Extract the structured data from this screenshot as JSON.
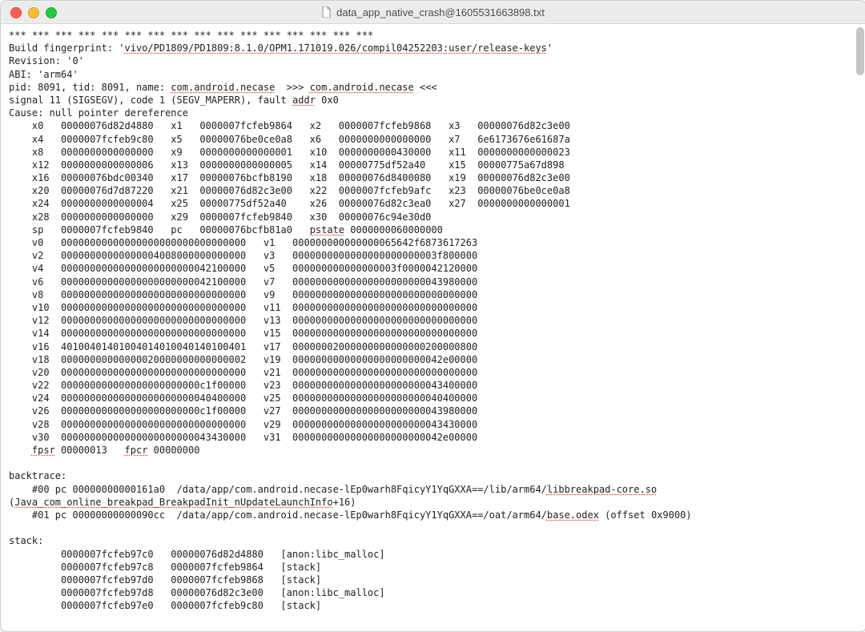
{
  "window": {
    "title": "data_app_native_crash@1605531663898.txt",
    "icon": "document-icon"
  },
  "header": {
    "stars": "*** *** *** *** *** *** *** *** *** *** *** *** *** *** *** ***",
    "build_prefix": "Build fingerprint: '",
    "build_value": "vivo/PD1809/PD1809:8.1.0/OPM1.171019.026/compil04252203:user/release-keys",
    "build_suffix": "'",
    "revision": "Revision: '0'",
    "abi": "ABI: 'arm64'",
    "pid_prefix": "pid: 8091, tid: 8091, name: ",
    "pid_name": "com.android.necase",
    "pid_mid": "  >>> ",
    "pid_name2": "com.android.necase",
    "pid_suffix": " <<<",
    "signal_prefix": "signal 11 (SIGSEGV), code 1 (SEGV_MAPERR), fault ",
    "signal_addr_label": "addr",
    "signal_addr_value": " 0x0",
    "cause": "Cause: null pointer dereference"
  },
  "xregs": [
    [
      "x0 ",
      "00000076d82d4880",
      "x1 ",
      "0000007fcfeb9864",
      "x2 ",
      "0000007fcfeb9868",
      "x3 ",
      "00000076d82c3e00"
    ],
    [
      "x4 ",
      "0000007fcfeb9c80",
      "x5 ",
      "00000076be0ce0a8",
      "x6 ",
      "0000000000000000",
      "x7 ",
      "6e6173676e61687a"
    ],
    [
      "x8 ",
      "0000000000000000",
      "x9 ",
      "0000000000000001",
      "x10",
      "0000000000430000",
      "x11",
      "0000000000000023"
    ],
    [
      "x12",
      "0000000000000006",
      "x13",
      "0000000000000005",
      "x14",
      "00000775df52a40",
      "x15",
      "00000775a67d898"
    ],
    [
      "x16",
      "00000076bdc00340",
      "x17",
      "00000076bcfb8190",
      "x18",
      "00000076d8400080",
      "x19",
      "00000076d82c3e00"
    ],
    [
      "x20",
      "00000076d7d87220",
      "x21",
      "00000076d82c3e00",
      "x22",
      "0000007fcfeb9afc",
      "x23",
      "00000076be0ce0a8"
    ],
    [
      "x24",
      "0000000000000004",
      "x25",
      "00000775df52a40",
      "x26",
      "00000076d82c3ea0",
      "x27",
      "0000000000000001"
    ],
    [
      "x28",
      "0000000000000000",
      "x29",
      "0000007fcfeb9840",
      "x30",
      "00000076c94e30d0",
      "",
      ""
    ]
  ],
  "sp_pc": {
    "sp_label": "sp ",
    "sp": "0000007fcfeb9840",
    "pc_label": "pc ",
    "pc": "00000076bcfb81a0",
    "pstate_label": "pstate",
    "pstate": "0000000060000000"
  },
  "vregs": [
    [
      "v0 ",
      "00000000000000000000000000000000",
      "v1 ",
      "000000000000000065642f6873617263"
    ],
    [
      "v2 ",
      "00000000000000004008000000000000",
      "v3 ",
      "0000000000000000000000003f800000"
    ],
    [
      "v4 ",
      "00000000000000000000000042100000",
      "v5 ",
      "000000000000000003f0000042120000"
    ],
    [
      "v6 ",
      "00000000000000000000000042100000",
      "v7 ",
      "00000000000000000000000043980000"
    ],
    [
      "v8 ",
      "00000000000000000000000000000000",
      "v9 ",
      "00000000000000000000000000000000"
    ],
    [
      "v10",
      "00000000000000000000000000000000",
      "v11",
      "00000000000000000000000000000000"
    ],
    [
      "v12",
      "00000000000000000000000000000000",
      "v13",
      "00000000000000000000000000000000"
    ],
    [
      "v14",
      "00000000000000000000000000000000",
      "v15",
      "00000000000000000000000000000000"
    ],
    [
      "v16",
      "40100401401004014010040140100401",
      "v17",
      "00000002000000000000000200000800"
    ],
    [
      "v18",
      "00000000000000020000000000000002",
      "v19",
      "00000000000000000000000042e00000"
    ],
    [
      "v20",
      "00000000000000000000000000000000",
      "v21",
      "00000000000000000000000000000000"
    ],
    [
      "v22",
      "000000000000000000000000c1f00000",
      "v23",
      "00000000000000000000000043400000"
    ],
    [
      "v24",
      "00000000000000000000000040400000",
      "v25",
      "00000000000000000000000040400000"
    ],
    [
      "v26",
      "000000000000000000000000c1f00000",
      "v27",
      "00000000000000000000000043980000"
    ],
    [
      "v28",
      "00000000000000000000000000000000",
      "v29",
      "00000000000000000000000043430000"
    ],
    [
      "v30",
      "00000000000000000000000043430000",
      "v31",
      "00000000000000000000000042e00000"
    ]
  ],
  "fpsr_line": {
    "fpsr_label": "fpsr",
    "fpsr": "00000013",
    "fpcr_label": "fpcr",
    "fpcr": "00000000"
  },
  "backtrace": {
    "title": "backtrace:",
    "f0_prefix": "    #00 pc 00000000000161a0  /data/app/com.android.necase-lEp0warh8FqicyY1YqGXXA==/lib/arm64/",
    "f0_lib": "libbreakpad-core.so",
    "f0_line2_prefix": "(",
    "f0_sym": "Java_com_online_breakpad_BreakpadInit_nUpdateLaunchInfo",
    "f0_line2_suffix": "+16)",
    "f1_prefix": "    #01 pc 00000000000090cc  /data/app/com.android.necase-lEp0warh8FqicyY1YqGXXA==/oat/arm64/",
    "f1_lib": "base.odex",
    "f1_suffix": " (offset 0x9000)"
  },
  "stack": {
    "title": "stack:",
    "rows": [
      [
        "0000007fcfeb97c0",
        "00000076d82d4880",
        "[anon:libc_malloc]"
      ],
      [
        "0000007fcfeb97c8",
        "0000007fcfeb9864",
        "[stack]"
      ],
      [
        "0000007fcfeb97d0",
        "0000007fcfeb9868",
        "[stack]"
      ],
      [
        "0000007fcfeb97d8",
        "00000076d82c3e00",
        "[anon:libc_malloc]"
      ],
      [
        "0000007fcfeb97e0",
        "0000007fcfeb9c80",
        "[stack]"
      ]
    ]
  }
}
